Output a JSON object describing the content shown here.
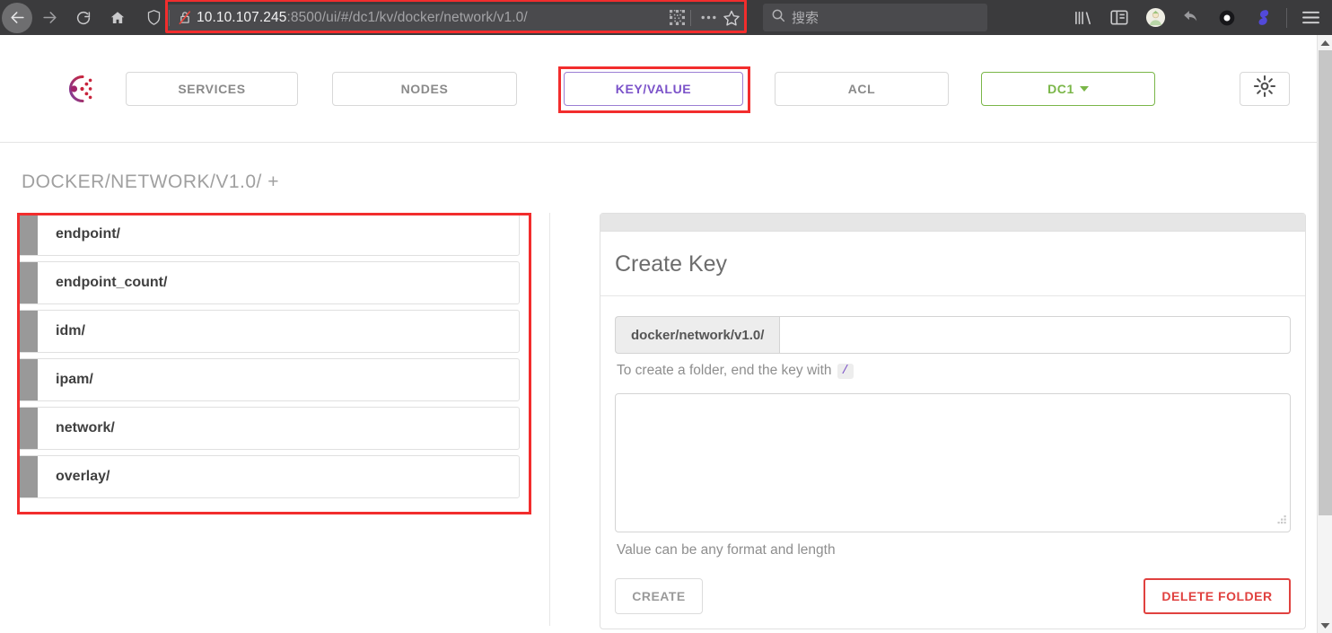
{
  "browser": {
    "nav": {
      "back": "back-arrow",
      "forward": "forward-arrow",
      "reload": "reload",
      "home": "home"
    },
    "url": {
      "host": "10.10.107.245",
      "rest": ":8500/ui/#/dc1/kv/docker/network/v1.0/",
      "security_icon": "broken-lock",
      "shield_icon": "shield",
      "reader_icon": "qr-code",
      "menu_icon": "ellipsis",
      "bookmark_icon": "star"
    },
    "search": {
      "placeholder": "搜索",
      "icon": "search-icon"
    },
    "toolbar_icons": [
      "library-icon",
      "sidebar-icon",
      "account-avatar-icon",
      "undo-icon",
      "circle-icon",
      "pocket-icon",
      "hamburger-menu-icon"
    ]
  },
  "app": {
    "logo": "consul-logo",
    "tabs": [
      {
        "label": "SERVICES",
        "active": false
      },
      {
        "label": "NODES",
        "active": false
      },
      {
        "label": "KEY/VALUE",
        "active": true
      },
      {
        "label": "ACL",
        "active": false
      }
    ],
    "datacenter": {
      "label": "DC1",
      "caret": "caret-down-icon"
    },
    "settings_icon": "gear-icon",
    "breadcrumb": "DOCKER/NETWORK/V1.0/ +"
  },
  "kv_list": [
    {
      "label": "endpoint/"
    },
    {
      "label": "endpoint_count/"
    },
    {
      "label": "idm/"
    },
    {
      "label": "ipam/"
    },
    {
      "label": "network/"
    },
    {
      "label": "overlay/"
    }
  ],
  "create_panel": {
    "title": "Create Key",
    "key_prefix": "docker/network/v1.0/",
    "key_value": "",
    "key_placeholder": "",
    "key_help_text": "To create a folder, end the key with",
    "key_help_code": "/",
    "value_text": "",
    "value_help": "Value can be any format and length",
    "create_label": "CREATE",
    "delete_label": "DELETE FOLDER",
    "resize_grip": "resize-grip-icon"
  },
  "colors": {
    "accent_purple": "#7b52c9",
    "dc_green": "#7ab648",
    "danger_red": "#e0413f",
    "annotation_red": "#f22d2d",
    "chrome_bg": "#3b3b3d"
  }
}
